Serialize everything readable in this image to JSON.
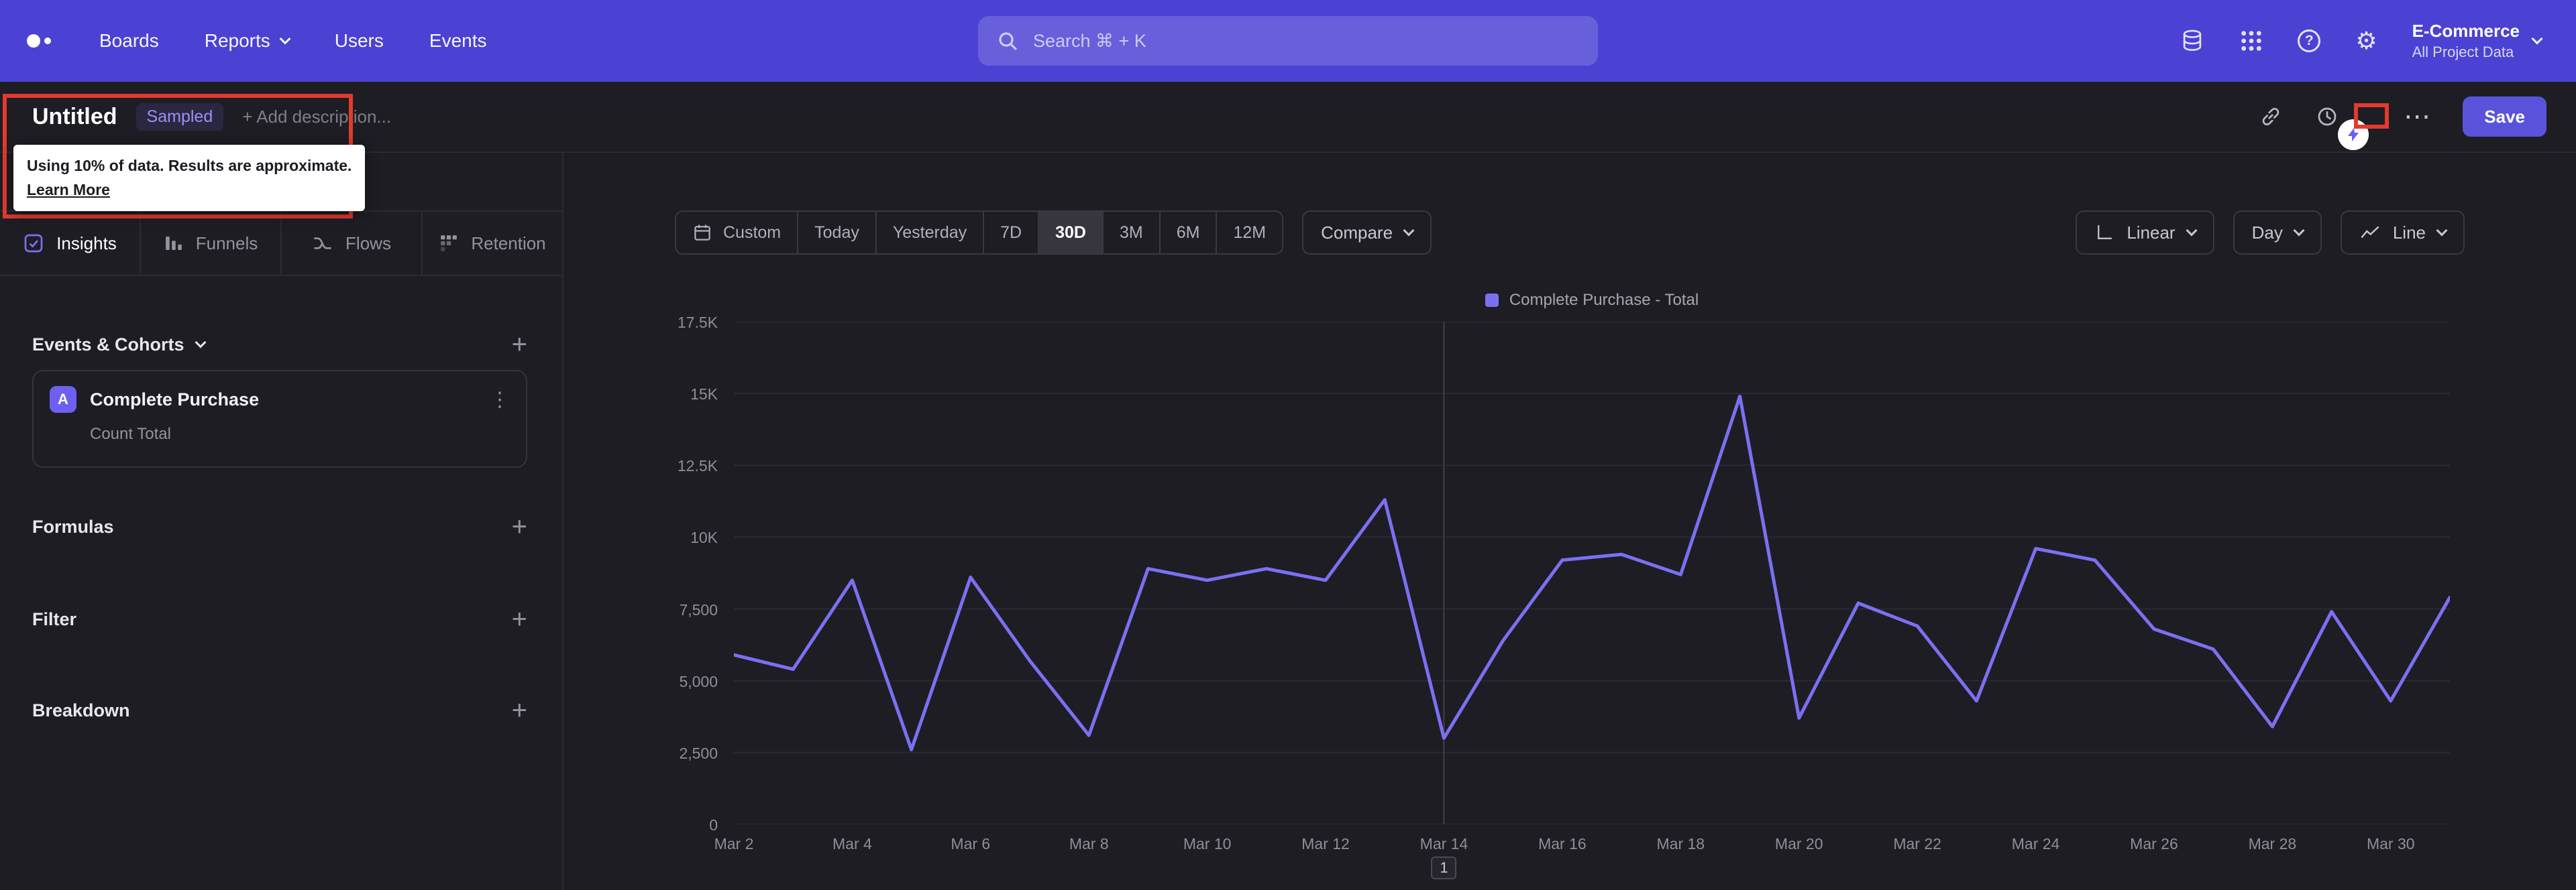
{
  "topnav": {
    "nav_items": [
      "Boards",
      "Reports",
      "Users",
      "Events"
    ],
    "search_placeholder": "Search  ⌘ + K",
    "project_name": "E-Commerce",
    "project_scope": "All Project Data"
  },
  "report_header": {
    "title": "Untitled",
    "sampled_badge": "Sampled",
    "add_description": "+ Add description...",
    "tooltip_text": "Using 10% of data. Results are approximate.",
    "tooltip_link": "Learn More",
    "save_label": "Save"
  },
  "sidebar": {
    "tabs": [
      "Insights",
      "Funnels",
      "Flows",
      "Retention"
    ],
    "selected_tab": "Insights",
    "events_cohorts_label": "Events & Cohorts",
    "event_card": {
      "badge": "A",
      "name": "Complete Purchase",
      "metric": "Count Total"
    },
    "sections": [
      "Formulas",
      "Filter",
      "Breakdown"
    ]
  },
  "controls": {
    "date_range_buttons": [
      "Custom",
      "Today",
      "Yesterday",
      "7D",
      "30D",
      "3M",
      "6M",
      "12M"
    ],
    "selected_range": "30D",
    "compare_label": "Compare",
    "smoothing_label": "Linear",
    "interval_label": "Day",
    "chart_type_label": "Line"
  },
  "chart_data": {
    "type": "line",
    "title": "",
    "grid": "horizontal",
    "legend_position": "top-center",
    "legend": [
      {
        "label": "Complete Purchase - Total",
        "color": "#7b70f2"
      }
    ],
    "x": [
      "Mar 2",
      "Mar 3",
      "Mar 4",
      "Mar 5",
      "Mar 6",
      "Mar 7",
      "Mar 8",
      "Mar 9",
      "Mar 10",
      "Mar 11",
      "Mar 12",
      "Mar 13",
      "Mar 14",
      "Mar 15",
      "Mar 16",
      "Mar 17",
      "Mar 18",
      "Mar 19",
      "Mar 20",
      "Mar 21",
      "Mar 22",
      "Mar 23",
      "Mar 24",
      "Mar 25",
      "Mar 26",
      "Mar 27",
      "Mar 28",
      "Mar 29",
      "Mar 30",
      "Mar 31"
    ],
    "series": [
      {
        "name": "Complete Purchase - Total",
        "color": "#7b70f2",
        "values": [
          5900,
          5400,
          8500,
          2600,
          8600,
          5700,
          3100,
          8900,
          8500,
          8900,
          8500,
          11300,
          3000,
          6400,
          9200,
          9400,
          8700,
          14900,
          3700,
          7700,
          6900,
          4300,
          9600,
          9200,
          6800,
          6100,
          3400,
          7400,
          4300,
          7900
        ]
      }
    ],
    "ylim": [
      0,
      17500
    ],
    "yticks": [
      0,
      2500,
      5000,
      7500,
      10000,
      12500,
      15000,
      17500
    ],
    "ytick_labels": [
      "0",
      "2,500",
      "5,000",
      "7,500",
      "10K",
      "12.5K",
      "15K",
      "17.5K"
    ],
    "xtick_labels": [
      "Mar 2",
      "Mar 4",
      "Mar 6",
      "Mar 8",
      "Mar 10",
      "Mar 12",
      "Mar 14",
      "Mar 16",
      "Mar 18",
      "Mar 20",
      "Mar 22",
      "Mar 24",
      "Mar 26",
      "Mar 28",
      "Mar 30"
    ],
    "annotation_marker": {
      "label": "1",
      "x": "Mar 14"
    }
  }
}
